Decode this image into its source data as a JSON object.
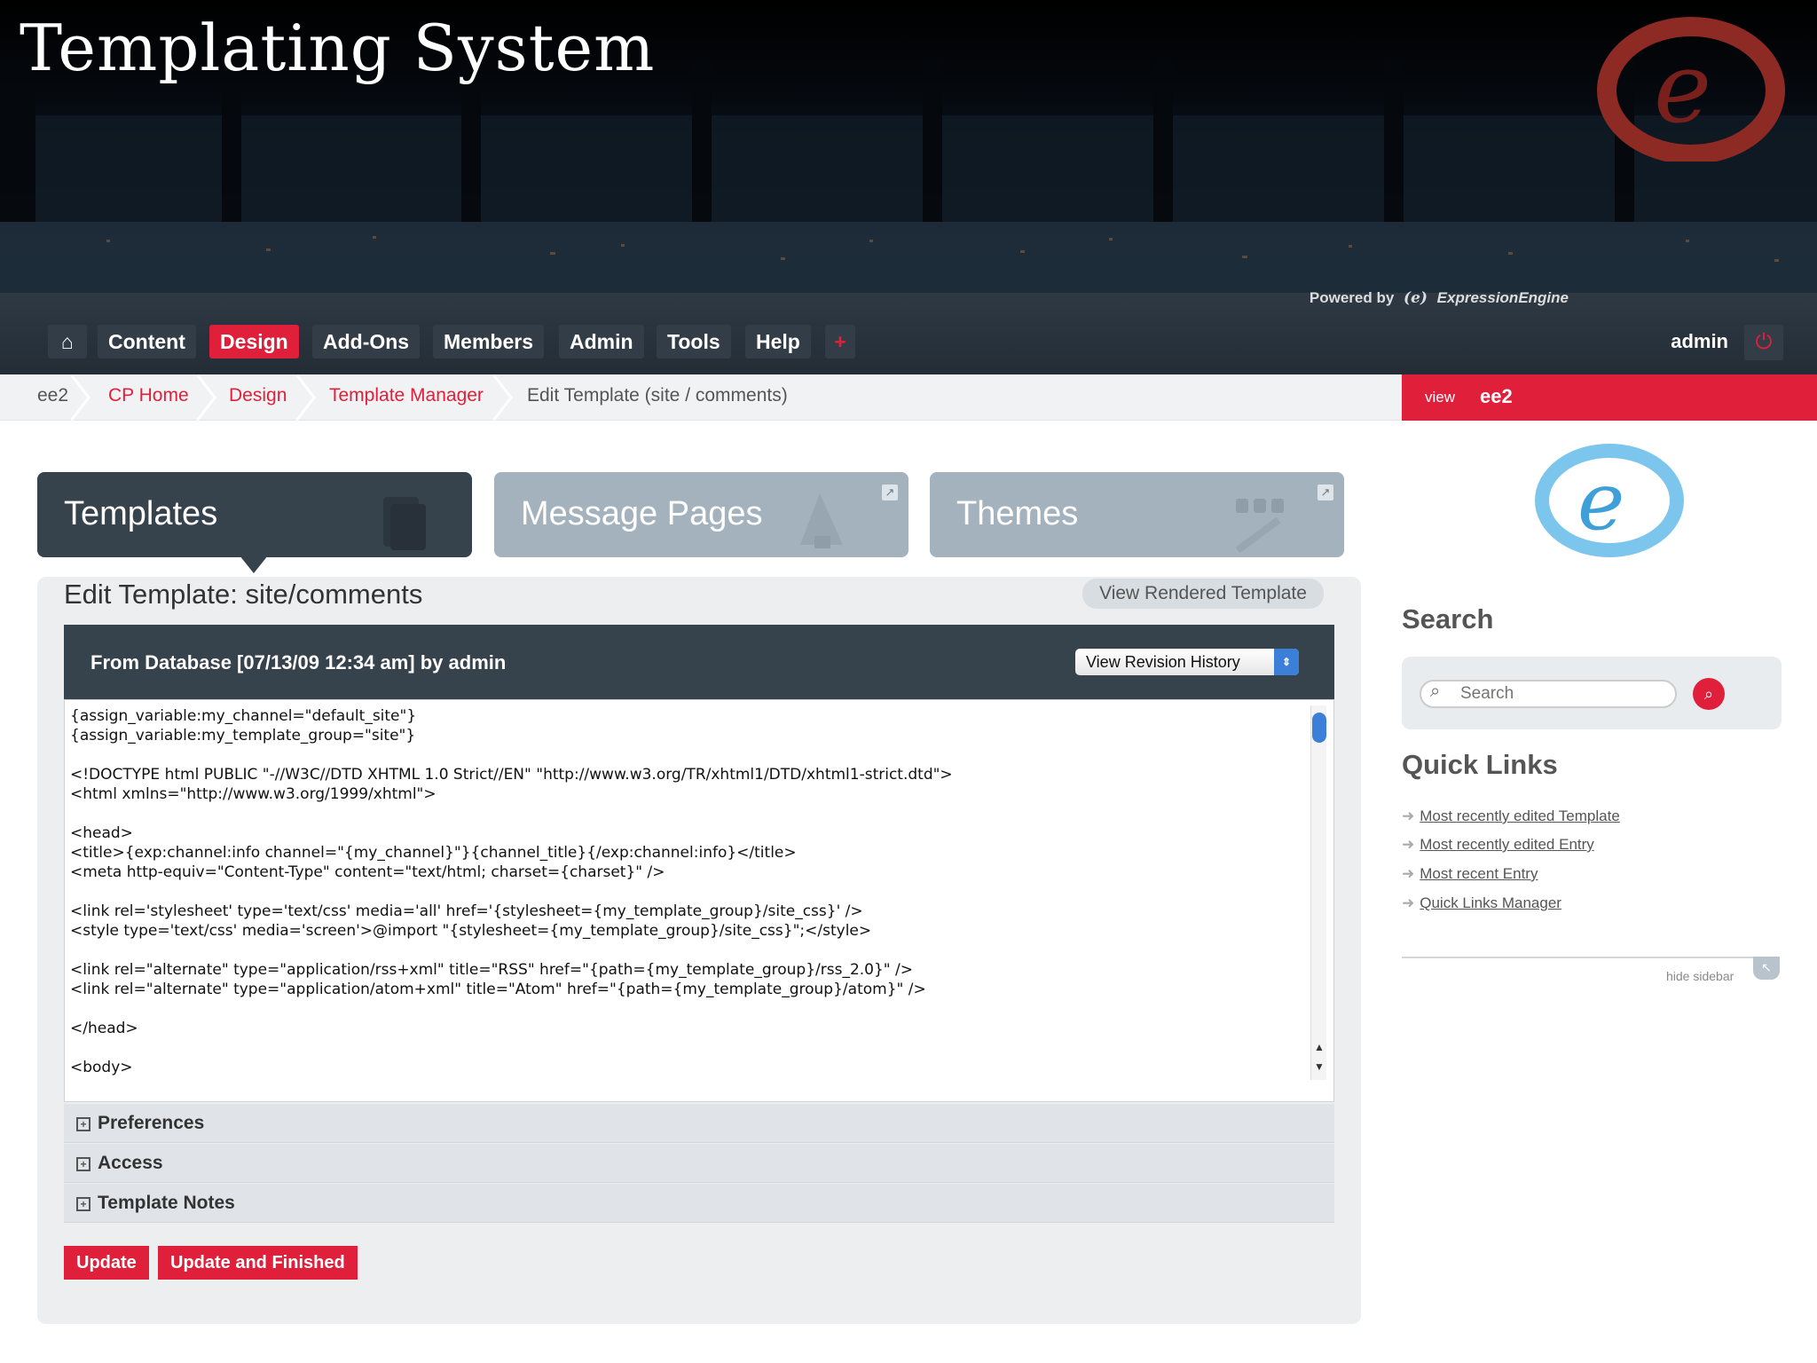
{
  "slide": {
    "title": "Templating System"
  },
  "header": {
    "powered_prefix": "Powered by",
    "powered_brand": "ExpressionEngine",
    "nav": [
      "Content",
      "Design",
      "Add-Ons",
      "Members",
      "Admin",
      "Tools",
      "Help"
    ],
    "user": "admin"
  },
  "breadcrumb": [
    "ee2",
    "CP Home",
    "Design",
    "Template Manager",
    "Edit Template (site / comments)"
  ],
  "view_bar": {
    "label": "view",
    "site": "ee2"
  },
  "tabs": {
    "templates": "Templates",
    "message_pages": "Message Pages",
    "themes": "Themes"
  },
  "edit": {
    "title": "Edit Template: site/comments",
    "view_rendered": "View Rendered Template",
    "revision_info": "From Database [07/13/09 12:34 am] by admin",
    "revision_select": "View Revision History"
  },
  "code_lines": [
    "{assign_variable:my_channel=\"default_site\"}",
    "{assign_variable:my_template_group=\"site\"}",
    "",
    "<!DOCTYPE html PUBLIC \"-//W3C//DTD XHTML 1.0 Strict//EN\" \"http://www.w3.org/TR/xhtml1/DTD/xhtml1-strict.dtd\">",
    "<html xmlns=\"http://www.w3.org/1999/xhtml\">",
    "",
    "<head>",
    "<title>{exp:channel:info channel=\"{my_channel}\"}{channel_title}{/exp:channel:info}</title>",
    "<meta http-equiv=\"Content-Type\" content=\"text/html; charset={charset}\" />",
    "",
    "<link rel='stylesheet' type='text/css' media='all' href='{stylesheet={my_template_group}/site_css}' />",
    "<style type='text/css' media='screen'>@import \"{stylesheet={my_template_group}/site_css}\";</style>",
    "",
    "<link rel=\"alternate\" type=\"application/rss+xml\" title=\"RSS\" href=\"{path={my_template_group}/rss_2.0}\" />",
    "<link rel=\"alternate\" type=\"application/atom+xml\" title=\"Atom\" href=\"{path={my_template_group}/atom}\" />",
    "",
    "</head>",
    "",
    "<body>"
  ],
  "options": [
    "Preferences",
    "Access",
    "Template Notes"
  ],
  "buttons": {
    "update": "Update",
    "update_finished": "Update and Finished"
  },
  "sidebar": {
    "search_title": "Search",
    "search_placeholder": "Search",
    "quick_links_title": "Quick Links",
    "quick_links": [
      "Most recently edited Template",
      "Most recently edited Entry",
      "Most recent Entry",
      "Quick Links Manager"
    ],
    "hide_label": "hide sidebar"
  },
  "colors": {
    "accent": "#e0203a",
    "nav_bg": "#2e3944",
    "dark_panel": "#36424c",
    "tab_inactive": "#a4b2bd"
  },
  "icons": [
    "expressionengine-logo-icon",
    "home-icon",
    "plus-icon",
    "power-icon",
    "search-icon",
    "expand-icon",
    "template-doc-icon",
    "megaphone-icon",
    "paintbrush-icon"
  ]
}
